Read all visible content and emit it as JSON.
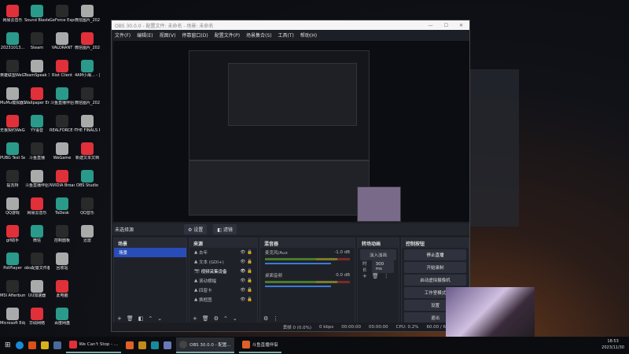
{
  "desktop": {
    "columns": [
      [
        "网易云音乐",
        "20231013...",
        "英雄联盟WeGame版",
        "MuMu模拟器12",
        "无畏契约WeGame版",
        "PUBG Test Server",
        "提瓦特",
        "QQ游戏",
        "gif助手",
        "PotPlayer",
        "MSI Afterburner",
        "Microsoft Edge"
      ],
      [
        "Sound Blaster ...",
        "Steam",
        "TeamSpeak 3",
        "Wallpaper Engine: ...",
        "YY语音",
        "斗鱼直播",
        "斗鱼直播伴侣",
        "网易云音乐",
        "微信",
        "obs配置文件备份",
        "UU加速器",
        "华硕网络"
      ],
      [
        "GeForce Experience",
        "VALORANT",
        "Riot Client",
        "斗鱼直播伴侣",
        "REALFORCE CONNECT",
        "WeGame",
        "NVIDIA Broadcast",
        "ToDesk",
        "控制面板",
        "回收站",
        "此电脑",
        "百度网盘"
      ],
      [
        "微信图片_2023110...",
        "微信图片_2023110...",
        "4AM小海... - 直播_jb...",
        "微信图片_2023102...",
        "THE FINALS PLAYTEST",
        "新建文本文档",
        "OBS Studio",
        "QQ音乐",
        "迅雷"
      ]
    ],
    "colors": [
      "#e0303a",
      "#2a9a8a",
      "#2a2a2a",
      "#aaaaaa"
    ]
  },
  "obs": {
    "title": "OBS 30.0.0 - 配置文件: 未命名 - 场景: 未命名",
    "menu": [
      "文件(F)",
      "编辑(E)",
      "视图(V)",
      "停靠窗口(D)",
      "配置文件(P)",
      "场景集合(S)",
      "工具(T)",
      "帮助(H)"
    ],
    "source_bar": {
      "label": "未选择源",
      "settings": "⚙ 设置",
      "filters": "◧ 滤镜"
    },
    "scenes": {
      "title": "场景",
      "items": [
        "场景"
      ]
    },
    "sources": {
      "title": "来源",
      "items": [
        "去年",
        "文本 (GDI+)",
        "视频采集设备",
        "滚动横幅",
        "四窗卡",
        "换框图"
      ]
    },
    "mixer": {
      "title": "混音器",
      "channels": [
        {
          "name": "麦克风/Aux",
          "db": "-1.0 dB"
        },
        {
          "name": "桌面音频",
          "db": "0.0 dB"
        }
      ]
    },
    "transitions": {
      "title": "转场动画",
      "type": "淡入淡出",
      "duration_label": "时长",
      "duration": "300 ms"
    },
    "controls": {
      "title": "控制按钮",
      "buttons": [
        "停止直播",
        "开始录制",
        "启动虚拟摄像机",
        "工作室模式",
        "设置",
        "退出"
      ]
    },
    "status": {
      "dropped": "丢帧 0 (0.0%)",
      "kbps": "0 kbps",
      "live": "00:00:00",
      "rec": "00:00:00",
      "cpu": "CPU: 0.2%",
      "fps": "60.00 / 60.00 FPS"
    }
  },
  "taskbar": {
    "apps": [
      "We Can't Stop - ...",
      "OBS 30.0.0 - 配置...",
      "斗鱼直播伴侣"
    ],
    "time": "18:53",
    "date": "2023/11/30"
  }
}
